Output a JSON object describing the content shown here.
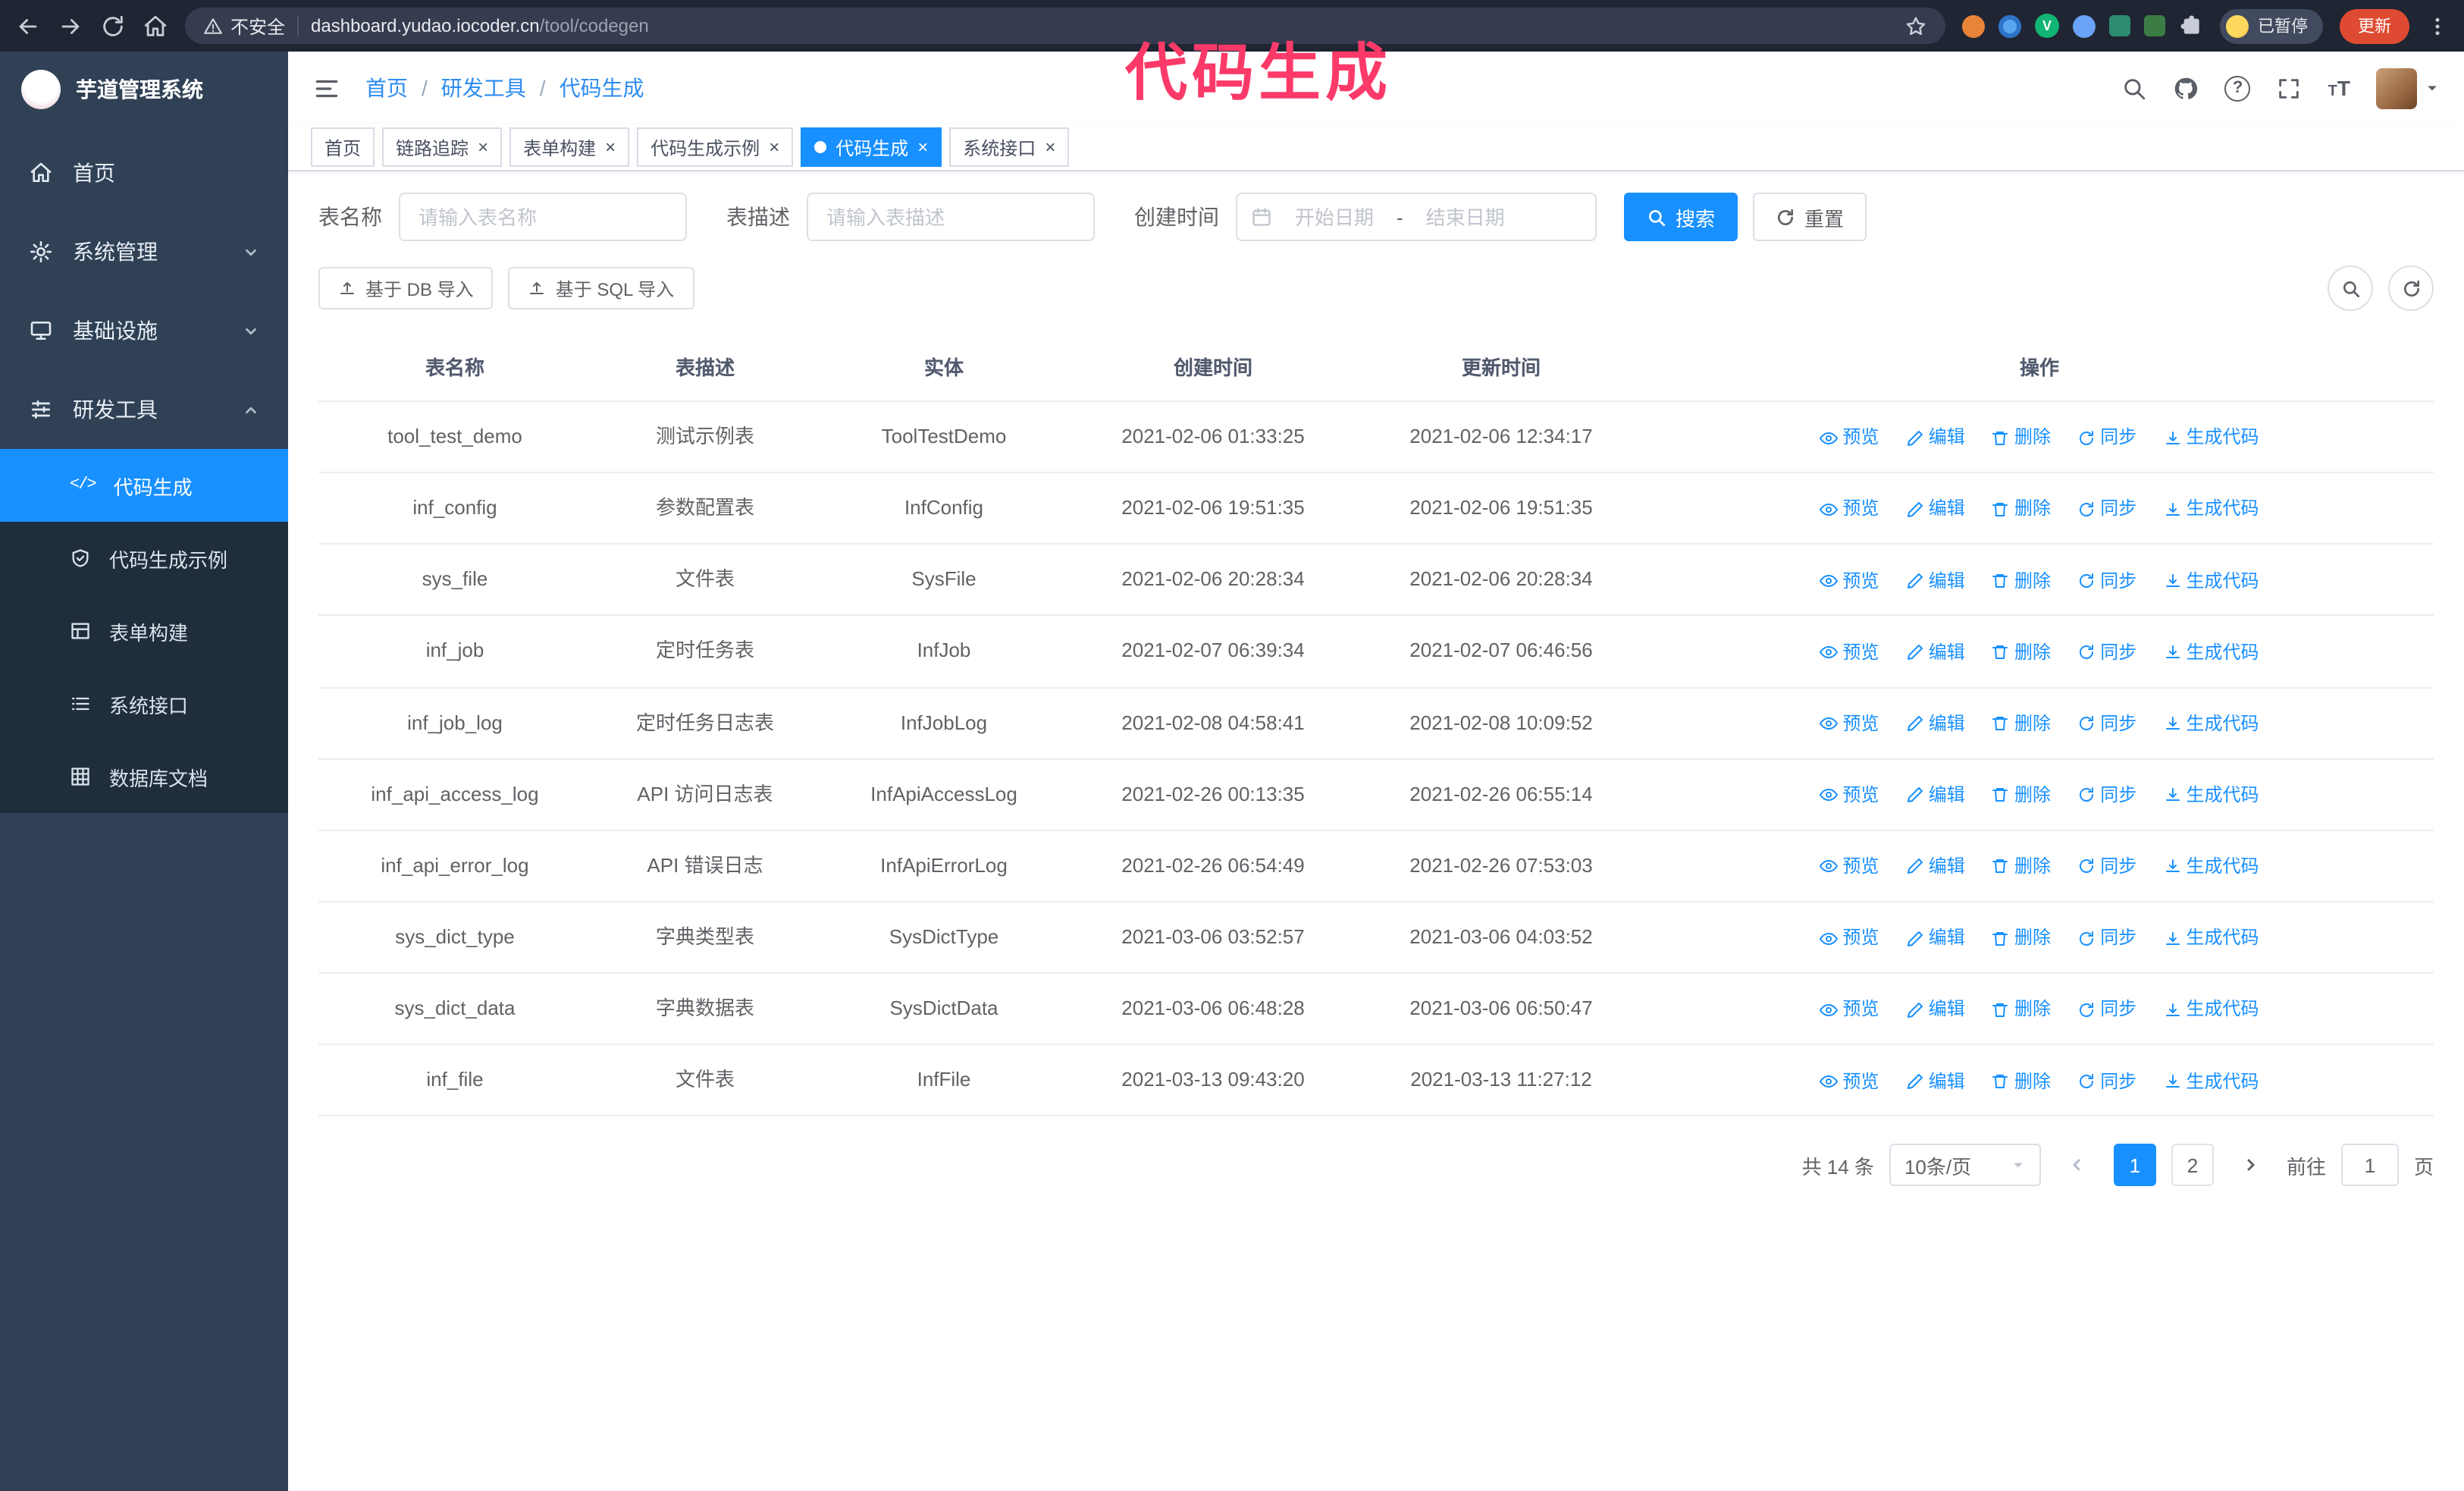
{
  "annotation": {
    "text": "代码生成",
    "color": "#fb3a69"
  },
  "browser": {
    "security_label": "不安全",
    "url_host": "dashboard.yudao.iocoder.cn",
    "url_path": "/tool/codegen",
    "profile_chip": "已暂停",
    "update_label": "更新"
  },
  "sidebar": {
    "logo_title": "芋道管理系统",
    "menu": [
      {
        "label": "首页"
      },
      {
        "label": "系统管理"
      },
      {
        "label": "基础设施"
      },
      {
        "label": "研发工具"
      }
    ],
    "submenu": [
      {
        "label": "代码生成",
        "active": true
      },
      {
        "label": "代码生成示例"
      },
      {
        "label": "表单构建"
      },
      {
        "label": "系统接口"
      },
      {
        "label": "数据库文档"
      }
    ]
  },
  "navbar": {
    "breadcrumb": {
      "home": "首页",
      "group": "研发工具",
      "current": "代码生成"
    }
  },
  "tabs": [
    {
      "label": "首页",
      "closable": false,
      "active": false
    },
    {
      "label": "链路追踪",
      "closable": true,
      "active": false
    },
    {
      "label": "表单构建",
      "closable": true,
      "active": false
    },
    {
      "label": "代码生成示例",
      "closable": true,
      "active": false
    },
    {
      "label": "代码生成",
      "closable": true,
      "active": true
    },
    {
      "label": "系统接口",
      "closable": true,
      "active": false
    }
  ],
  "filters": {
    "name_label": "表名称",
    "name_placeholder": "请输入表名称",
    "desc_label": "表描述",
    "desc_placeholder": "请输入表描述",
    "time_label": "创建时间",
    "start_placeholder": "开始日期",
    "range_separator": "-",
    "end_placeholder": "结束日期",
    "search_label": "搜索",
    "reset_label": "重置"
  },
  "toolbar": {
    "db_import_label": "基于 DB 导入",
    "sql_import_label": "基于 SQL 导入"
  },
  "table": {
    "columns": [
      "表名称",
      "表描述",
      "实体",
      "创建时间",
      "更新时间",
      "操作"
    ],
    "actions": [
      {
        "label": "预览"
      },
      {
        "label": "编辑"
      },
      {
        "label": "删除"
      },
      {
        "label": "同步"
      },
      {
        "label": "生成代码"
      }
    ],
    "rows": [
      {
        "name": "tool_test_demo",
        "desc": "测试示例表",
        "entity": "ToolTestDemo",
        "created": "2021-02-06 01:33:25",
        "updated": "2021-02-06 12:34:17"
      },
      {
        "name": "inf_config",
        "desc": "参数配置表",
        "entity": "InfConfig",
        "created": "2021-02-06 19:51:35",
        "updated": "2021-02-06 19:51:35"
      },
      {
        "name": "sys_file",
        "desc": "文件表",
        "entity": "SysFile",
        "created": "2021-02-06 20:28:34",
        "updated": "2021-02-06 20:28:34"
      },
      {
        "name": "inf_job",
        "desc": "定时任务表",
        "entity": "InfJob",
        "created": "2021-02-07 06:39:34",
        "updated": "2021-02-07 06:46:56"
      },
      {
        "name": "inf_job_log",
        "desc": "定时任务日志表",
        "entity": "InfJobLog",
        "created": "2021-02-08 04:58:41",
        "updated": "2021-02-08 10:09:52"
      },
      {
        "name": "inf_api_access_log",
        "desc": "API 访问日志表",
        "entity": "InfApiAccessLog",
        "created": "2021-02-26 00:13:35",
        "updated": "2021-02-26 06:55:14"
      },
      {
        "name": "inf_api_error_log",
        "desc": "API 错误日志",
        "entity": "InfApiErrorLog",
        "created": "2021-02-26 06:54:49",
        "updated": "2021-02-26 07:53:03"
      },
      {
        "name": "sys_dict_type",
        "desc": "字典类型表",
        "entity": "SysDictType",
        "created": "2021-03-06 03:52:57",
        "updated": "2021-03-06 04:03:52"
      },
      {
        "name": "sys_dict_data",
        "desc": "字典数据表",
        "entity": "SysDictData",
        "created": "2021-03-06 06:48:28",
        "updated": "2021-03-06 06:50:47"
      },
      {
        "name": "inf_file",
        "desc": "文件表",
        "entity": "InfFile",
        "created": "2021-03-13 09:43:20",
        "updated": "2021-03-13 11:27:12"
      }
    ]
  },
  "pagination": {
    "total": "共 14 条",
    "page_size": "10条/页",
    "pages": [
      {
        "label": "1",
        "active": true
      },
      {
        "label": "2",
        "active": false
      }
    ],
    "goto_prefix": "前往",
    "goto_value": "1",
    "goto_suffix": "页"
  },
  "colors": {
    "accent": "#1890ff",
    "sidebar_bg": "#304156",
    "submenu_bg": "#1f2d3d",
    "annotation": "#fb3a69"
  }
}
